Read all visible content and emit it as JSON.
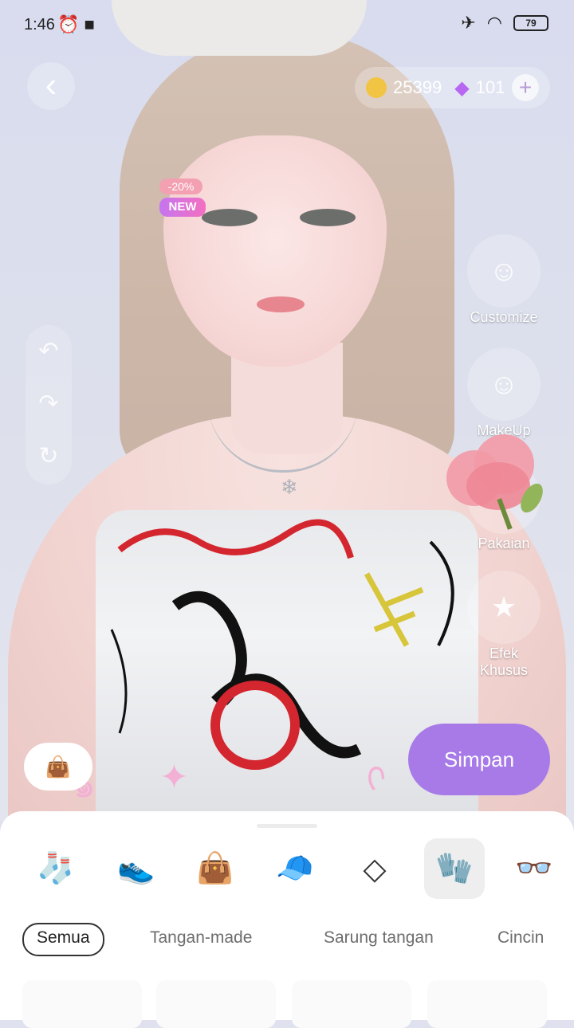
{
  "status_bar": {
    "time": "1:46",
    "battery": "79"
  },
  "currency": {
    "coins": "25399",
    "gems": "101"
  },
  "side_menu": {
    "customize": "Customize",
    "makeup": "MakeUp",
    "outfit": "Pakaian",
    "effects": "Efek Khusus"
  },
  "actions": {
    "save": "Simpan"
  },
  "category_icons": [
    "sock-icon",
    "sneaker-icon",
    "handbag-icon",
    "cap-icon",
    "necklace-icon",
    "glove-icon",
    "glasses-icon"
  ],
  "tabs": {
    "all": "Semua",
    "handmade": "Tangan-made",
    "gloves": "Sarung tangan",
    "rings": "Cincin"
  },
  "item_badges": {
    "sale": "-20%",
    "new": "NEW"
  },
  "colors": {
    "accent": "#a77ae8",
    "coin": "#f2c443",
    "gem": "#b867f2"
  }
}
